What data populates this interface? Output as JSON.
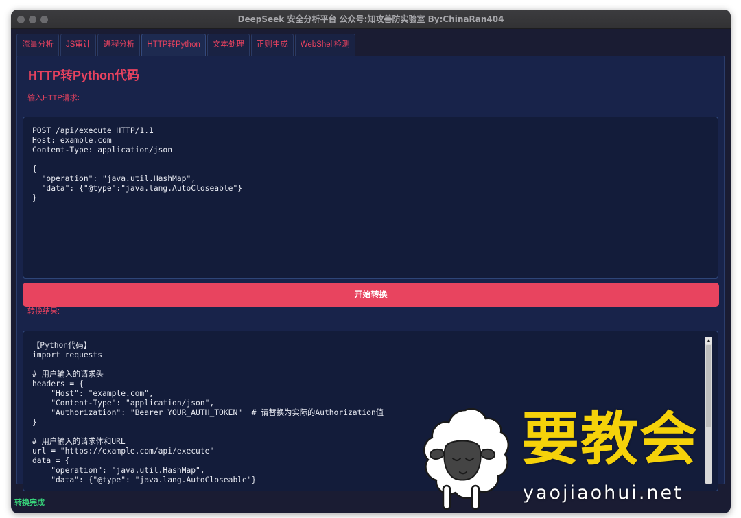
{
  "window": {
    "title": "DeepSeek 安全分析平台 公众号:知攻善防实验室 By:ChinaRan404"
  },
  "tabs": [
    {
      "label": "流量分析",
      "active": false
    },
    {
      "label": "JS审计",
      "active": false
    },
    {
      "label": "进程分析",
      "active": false
    },
    {
      "label": "HTTP转Python",
      "active": true
    },
    {
      "label": "文本处理",
      "active": false
    },
    {
      "label": "正则生成",
      "active": false
    },
    {
      "label": "WebShell检测",
      "active": false
    }
  ],
  "panel": {
    "title": "HTTP转Python代码",
    "input_label": "输入HTTP请求:",
    "input_value": "POST /api/execute HTTP/1.1\nHost: example.com\nContent-Type: application/json\n\n{\n  \"operation\": \"java.util.HashMap\",\n  \"data\": {\"@type\":\"java.lang.AutoCloseable\"}\n}",
    "convert_button": "开始转换",
    "output_label": "转换结果:",
    "output_value": "【Python代码】\nimport requests\n\n# 用户输入的请求头\nheaders = {\n    \"Host\": \"example.com\",\n    \"Content-Type\": \"application/json\",\n    \"Authorization\": \"Bearer YOUR_AUTH_TOKEN\"  # 请替换为实际的Authorization值\n}\n\n# 用户输入的请求体和URL\nurl = \"https://example.com/api/execute\"\ndata = {\n    \"operation\": \"java.util.HashMap\",\n    \"data\": {\"@type\": \"java.lang.AutoCloseable\"}"
  },
  "status": {
    "text": "转换完成"
  },
  "watermark": {
    "logo_text": "要教会",
    "url": "yaojiaohui.net",
    "mascot": "sheep-icon"
  },
  "colors": {
    "accent": "#e8445f",
    "background": "#1a1c33",
    "panel": "#18234a",
    "status_ok": "#37d27a",
    "watermark": "#f5d20a"
  }
}
